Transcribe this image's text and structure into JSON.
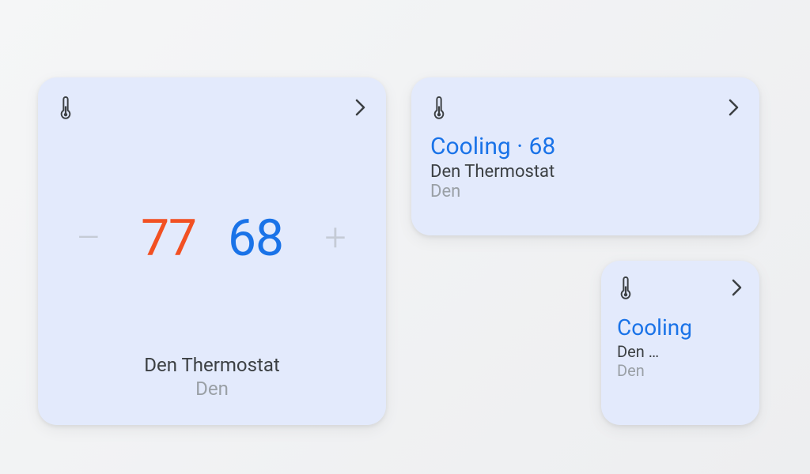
{
  "large_card": {
    "heat_setpoint": "77",
    "cool_setpoint": "68",
    "device_name": "Den Thermostat",
    "room": "Den",
    "decrease": "–",
    "increase": "+"
  },
  "medium_card": {
    "status": "Cooling · 68",
    "device_name": "Den Thermostat",
    "room": "Den"
  },
  "small_card": {
    "status": "Cooling",
    "device_name": "Den …",
    "room": "Den"
  }
}
